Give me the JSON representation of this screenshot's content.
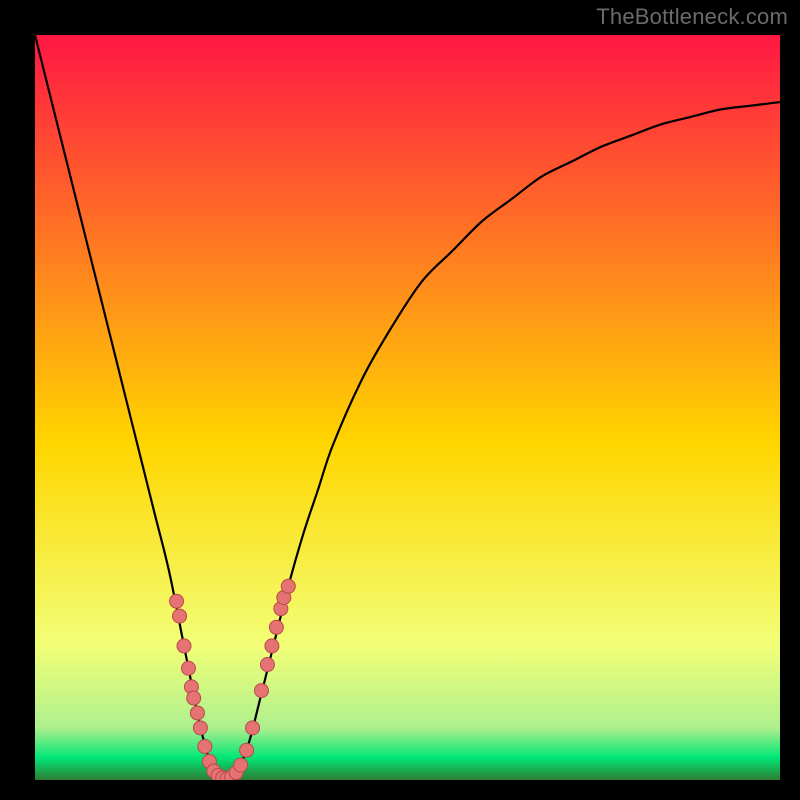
{
  "watermark": "TheBottleneck.com",
  "colors": {
    "frame": "#000000",
    "gradient_top": "#ff1744",
    "gradient_mid": "#ffd600",
    "gradient_green": "#00e676",
    "gradient_bottom": "#2e7d32",
    "curve": "#000000",
    "dot_fill": "#e57373",
    "dot_stroke": "#b94a4a"
  },
  "chart_data": {
    "type": "line",
    "title": "",
    "xlabel": "",
    "ylabel": "",
    "xlim": [
      0,
      100
    ],
    "ylim": [
      0,
      100
    ],
    "series": [
      {
        "name": "bottleneck-curve",
        "x": [
          0,
          2,
          4,
          6,
          8,
          10,
          12,
          14,
          16,
          18,
          20,
          21,
          22,
          23,
          24,
          25,
          26,
          27,
          28,
          29,
          30,
          32,
          34,
          36,
          38,
          40,
          44,
          48,
          52,
          56,
          60,
          64,
          68,
          72,
          76,
          80,
          84,
          88,
          92,
          96,
          100
        ],
        "y": [
          100,
          92,
          84,
          76,
          68,
          60,
          52,
          44,
          36,
          28,
          18,
          13,
          8,
          4,
          1,
          0,
          0,
          1,
          3,
          6,
          10,
          18,
          26,
          33,
          39,
          45,
          54,
          61,
          67,
          71,
          75,
          78,
          81,
          83,
          85,
          86.5,
          88,
          89,
          90,
          90.5,
          91
        ]
      }
    ],
    "dots": [
      {
        "x": 19.0,
        "y": 24
      },
      {
        "x": 19.4,
        "y": 22
      },
      {
        "x": 20.0,
        "y": 18
      },
      {
        "x": 20.6,
        "y": 15
      },
      {
        "x": 21.0,
        "y": 12.5
      },
      {
        "x": 21.3,
        "y": 11
      },
      {
        "x": 21.8,
        "y": 9
      },
      {
        "x": 22.2,
        "y": 7
      },
      {
        "x": 22.8,
        "y": 4.5
      },
      {
        "x": 23.4,
        "y": 2.5
      },
      {
        "x": 24.0,
        "y": 1.2
      },
      {
        "x": 24.6,
        "y": 0.6
      },
      {
        "x": 25.2,
        "y": 0.3
      },
      {
        "x": 25.8,
        "y": 0.2
      },
      {
        "x": 26.4,
        "y": 0.4
      },
      {
        "x": 27.0,
        "y": 1.0
      },
      {
        "x": 27.6,
        "y": 2.0
      },
      {
        "x": 28.4,
        "y": 4.0
      },
      {
        "x": 29.2,
        "y": 7.0
      },
      {
        "x": 30.4,
        "y": 12.0
      },
      {
        "x": 31.2,
        "y": 15.5
      },
      {
        "x": 31.8,
        "y": 18.0
      },
      {
        "x": 32.4,
        "y": 20.5
      },
      {
        "x": 33.0,
        "y": 23.0
      },
      {
        "x": 33.4,
        "y": 24.5
      },
      {
        "x": 34.0,
        "y": 26.0
      }
    ]
  }
}
